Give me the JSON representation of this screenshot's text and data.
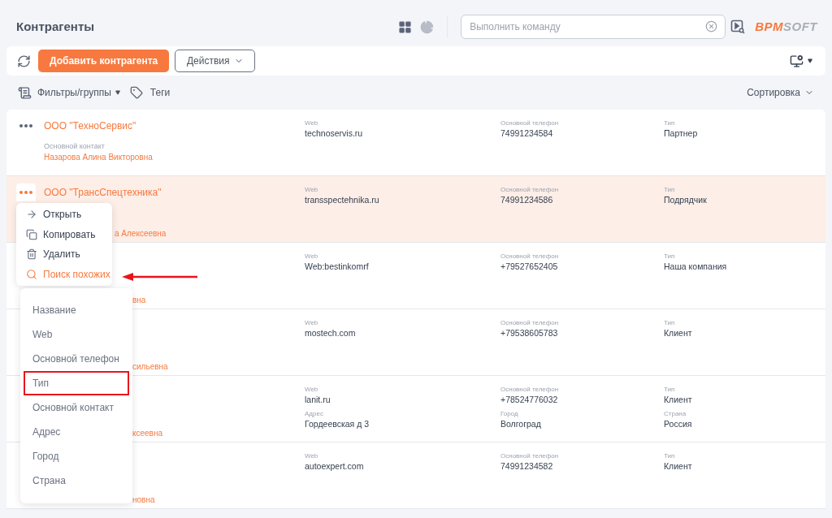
{
  "header": {
    "title": "Контрагенты",
    "command": {
      "placeholder": "Выполнить команду"
    },
    "logo": {
      "accent": "BPM",
      "rest": "SOFT"
    }
  },
  "toolbar": {
    "add_button": "Добавить контрагента",
    "actions_button": "Действия"
  },
  "filters": {
    "filters_groups": "Фильтры/группы",
    "tags": "Теги",
    "sort": "Сортировка"
  },
  "rows": [
    {
      "kind": "full",
      "selected": false,
      "name": "ООО \"ТехноСервис\"",
      "contact_label": "Основной контакт",
      "contact": "Назарова Алина Викторовна",
      "fields": [
        {
          "label": "Web",
          "value": "technoservis.ru"
        },
        {
          "label": "Основной телефон",
          "value": "74991234584"
        },
        {
          "label": "Тип",
          "value": "Партнер"
        }
      ]
    },
    {
      "kind": "open",
      "selected": true,
      "name": "ООО \"ТрансСпецтехника\"",
      "contact": "а Алексеевна",
      "fields": [
        {
          "label": "Web",
          "value": "transspectehnika.ru"
        },
        {
          "label": "Основной телефон",
          "value": "74991234586"
        },
        {
          "label": "Тип",
          "value": "Подрядчик"
        }
      ]
    },
    {
      "kind": "covered",
      "selected": false,
      "contact": "вна",
      "fields": [
        {
          "label": "Web",
          "value": "Web:bestinkomrf"
        },
        {
          "label": "Основной телефон",
          "value": "+79527652405"
        },
        {
          "label": "Тип",
          "value": "Наша компания"
        }
      ]
    },
    {
      "kind": "covered",
      "selected": false,
      "contact": "сильевна",
      "fields": [
        {
          "label": "Web",
          "value": "mostech.com"
        },
        {
          "label": "Основной телефон",
          "value": "+79538605783"
        },
        {
          "label": "Тип",
          "value": "Клиент"
        }
      ]
    },
    {
      "kind": "covered",
      "selected": false,
      "contact": "ксеевна",
      "fields": [
        {
          "label": "Web",
          "value": "lanit.ru"
        },
        {
          "label": "Основной телефон",
          "value": "+78524776032"
        },
        {
          "label": "Тип",
          "value": "Клиент"
        },
        {
          "label": "Адрес",
          "value": "Гордеевская д 3"
        },
        {
          "label": "Город",
          "value": "Волгоград"
        },
        {
          "label": "Страна",
          "value": "Россия"
        }
      ]
    },
    {
      "kind": "covered",
      "selected": false,
      "contact": "новна",
      "fields": [
        {
          "label": "Web",
          "value": "autoexpert.com"
        },
        {
          "label": "Основной телефон",
          "value": "74991234582"
        },
        {
          "label": "Тип",
          "value": "Клиент"
        }
      ]
    }
  ],
  "row_menu": {
    "items": [
      {
        "kind": "open",
        "label": "Открыть",
        "selected": false
      },
      {
        "kind": "copy",
        "label": "Копировать",
        "selected": false
      },
      {
        "kind": "delete",
        "label": "Удалить",
        "selected": false
      },
      {
        "kind": "search",
        "label": "Поиск похожих",
        "selected": true
      }
    ]
  },
  "similar_menu": {
    "items": [
      {
        "label": "Название",
        "marked": false
      },
      {
        "label": "Web",
        "marked": false
      },
      {
        "label": "Основной телефон",
        "marked": false
      },
      {
        "label": "Тип",
        "marked": true
      },
      {
        "label": "Основной контакт",
        "marked": false
      },
      {
        "label": "Адрес",
        "marked": false
      },
      {
        "label": "Город",
        "marked": false
      },
      {
        "label": "Страна",
        "marked": false
      }
    ]
  }
}
